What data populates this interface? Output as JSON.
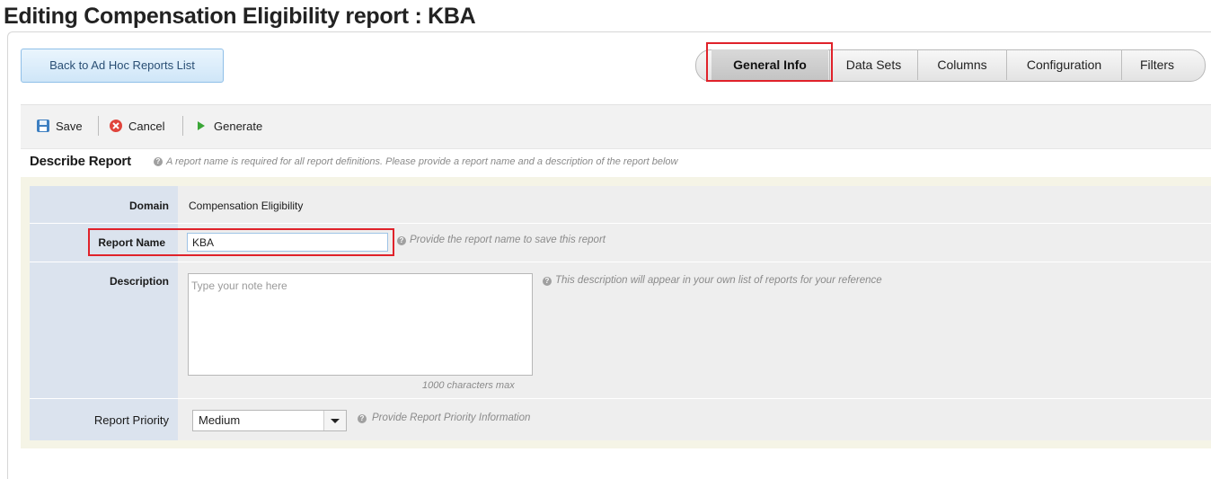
{
  "page": {
    "title": "Editing Compensation Eligibility report : KBA"
  },
  "nav": {
    "back_label": "Back to Ad Hoc Reports List",
    "tabs": [
      "General Info",
      "Data Sets",
      "Columns",
      "Configuration",
      "Filters"
    ],
    "active_tab": "General Info"
  },
  "toolbar": {
    "save": "Save",
    "cancel": "Cancel",
    "generate": "Generate"
  },
  "section": {
    "title": "Describe Report",
    "hint": "A report name is required for all report definitions. Please provide a report name and a description of the report below"
  },
  "form": {
    "domain": {
      "label": "Domain",
      "value": "Compensation Eligibility"
    },
    "report_name": {
      "label": "Report Name",
      "value": "KBA",
      "hint": "Provide the report name to save this report"
    },
    "description": {
      "label": "Description",
      "placeholder": "Type your note here",
      "value": "",
      "hint": "This description will appear in your own list of reports for your reference",
      "char_limit": "1000 characters max"
    },
    "priority": {
      "label": "Report Priority",
      "value": "Medium",
      "hint": "Provide Report Priority Information"
    }
  },
  "colors": {
    "highlight": "#e0222a",
    "label_column": "#dbe3ee",
    "panel": "#f5f4e6"
  }
}
